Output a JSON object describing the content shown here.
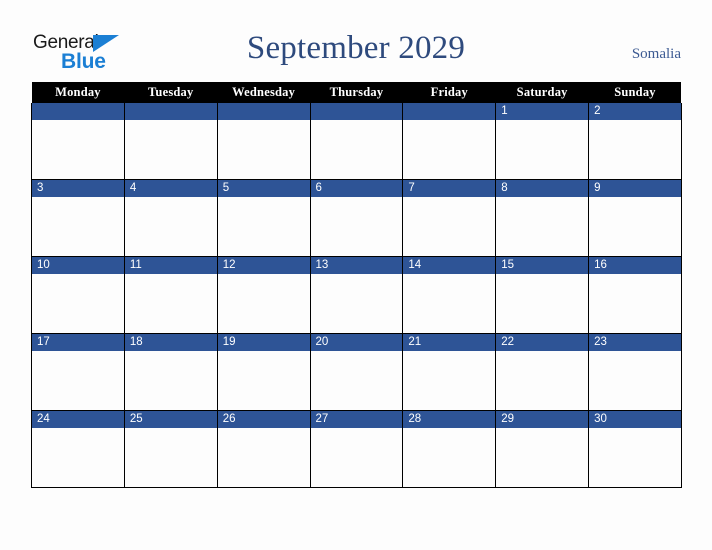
{
  "brand": {
    "name_part1": "General",
    "name_part2": "Blue",
    "triangle_icon": "blue-triangle-icon",
    "color_primary": "#1b7fd4",
    "color_text": "#1a1a1a"
  },
  "header": {
    "title": "September 2029",
    "month": "September",
    "year": "2029",
    "country": "Somalia",
    "title_color": "#2e4a7d"
  },
  "calendar": {
    "weekday_headers": [
      "Monday",
      "Tuesday",
      "Wednesday",
      "Thursday",
      "Friday",
      "Saturday",
      "Sunday"
    ],
    "header_background": "#000000",
    "header_text_color": "#ffffff",
    "date_bar_color": "#2e5496",
    "date_text_color": "#ffffff",
    "cell_background": "#fdfdfd",
    "grid_line_color": "#000000",
    "weeks": [
      {
        "days": [
          {
            "date": "",
            "events": []
          },
          {
            "date": "",
            "events": []
          },
          {
            "date": "",
            "events": []
          },
          {
            "date": "",
            "events": []
          },
          {
            "date": "",
            "events": []
          },
          {
            "date": "1",
            "events": []
          },
          {
            "date": "2",
            "events": []
          }
        ]
      },
      {
        "days": [
          {
            "date": "3",
            "events": []
          },
          {
            "date": "4",
            "events": []
          },
          {
            "date": "5",
            "events": []
          },
          {
            "date": "6",
            "events": []
          },
          {
            "date": "7",
            "events": []
          },
          {
            "date": "8",
            "events": []
          },
          {
            "date": "9",
            "events": []
          }
        ]
      },
      {
        "days": [
          {
            "date": "10",
            "events": []
          },
          {
            "date": "11",
            "events": []
          },
          {
            "date": "12",
            "events": []
          },
          {
            "date": "13",
            "events": []
          },
          {
            "date": "14",
            "events": []
          },
          {
            "date": "15",
            "events": []
          },
          {
            "date": "16",
            "events": []
          }
        ]
      },
      {
        "days": [
          {
            "date": "17",
            "events": []
          },
          {
            "date": "18",
            "events": []
          },
          {
            "date": "19",
            "events": []
          },
          {
            "date": "20",
            "events": []
          },
          {
            "date": "21",
            "events": []
          },
          {
            "date": "22",
            "events": []
          },
          {
            "date": "23",
            "events": []
          }
        ]
      },
      {
        "days": [
          {
            "date": "24",
            "events": []
          },
          {
            "date": "25",
            "events": []
          },
          {
            "date": "26",
            "events": []
          },
          {
            "date": "27",
            "events": []
          },
          {
            "date": "28",
            "events": []
          },
          {
            "date": "29",
            "events": []
          },
          {
            "date": "30",
            "events": []
          }
        ]
      }
    ]
  }
}
